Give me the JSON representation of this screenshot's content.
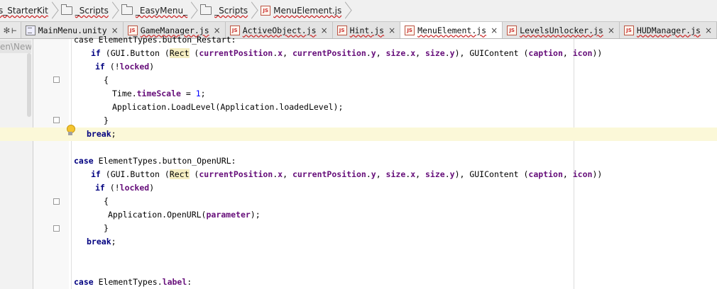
{
  "breadcrumbs": [
    {
      "label": "s_StarterKit",
      "icon": "folder-icon"
    },
    {
      "label": "_Scripts",
      "icon": "folder-icon"
    },
    {
      "label": "_EasyMenu_",
      "icon": "folder-icon"
    },
    {
      "label": "_Scripts",
      "icon": "folder-icon"
    },
    {
      "label": "MenuElement.js",
      "icon": "js-file-icon"
    }
  ],
  "project_path": "en\\New",
  "tabs": [
    {
      "label": "MainMenu.unity",
      "icon": "unity-scene-icon",
      "active": false,
      "error": false
    },
    {
      "label": "GameManager.js",
      "icon": "js-file-icon",
      "active": false,
      "error": true
    },
    {
      "label": "ActiveObject.js",
      "icon": "js-file-icon",
      "active": false,
      "error": true
    },
    {
      "label": "Hint.js",
      "icon": "js-file-icon",
      "active": false,
      "error": true
    },
    {
      "label": "MenuElement.js",
      "icon": "js-file-icon",
      "active": true,
      "error": true
    },
    {
      "label": "LevelsUnlocker.js",
      "icon": "js-file-icon",
      "active": false,
      "error": true
    },
    {
      "label": "HUDManager.js",
      "icon": "js-file-icon",
      "active": false,
      "error": true
    }
  ],
  "js_badge": "JS",
  "close_glyph": "×",
  "code_lines": [
    {
      "indent": 104,
      "parts": [
        [
          "plain",
          "case ElementTypes.button_Restart:"
        ]
      ]
    },
    {
      "indent": 128,
      "parts": [
        [
          "kw",
          "if "
        ],
        [
          "plain",
          "(GUI.Button ("
        ],
        [
          "rect",
          "Rect"
        ],
        [
          "plain",
          " ("
        ],
        [
          "prop",
          "currentPosition"
        ],
        [
          "plain",
          "."
        ],
        [
          "prop",
          "x"
        ],
        [
          "plain",
          ", "
        ],
        [
          "prop",
          "currentPosition"
        ],
        [
          "plain",
          "."
        ],
        [
          "prop",
          "y"
        ],
        [
          "plain",
          ", "
        ],
        [
          "prop",
          "size"
        ],
        [
          "plain",
          "."
        ],
        [
          "prop",
          "x"
        ],
        [
          "plain",
          ", "
        ],
        [
          "prop",
          "size"
        ],
        [
          "plain",
          "."
        ],
        [
          "prop",
          "y"
        ],
        [
          "plain",
          "), GUIContent ("
        ],
        [
          "prop",
          "caption"
        ],
        [
          "plain",
          ", "
        ],
        [
          "prop",
          "icon"
        ],
        [
          "plain",
          "))"
        ]
      ]
    },
    {
      "indent": 134,
      "parts": [
        [
          "kw",
          "if "
        ],
        [
          "plain",
          "(!"
        ],
        [
          "prop",
          "locked"
        ],
        [
          "plain",
          ")"
        ]
      ]
    },
    {
      "indent": 146,
      "parts": [
        [
          "plain",
          "{"
        ]
      ]
    },
    {
      "indent": 158,
      "parts": [
        [
          "plain",
          "Time."
        ],
        [
          "prop",
          "timeScale"
        ],
        [
          "plain",
          " = "
        ],
        [
          "num",
          "1"
        ],
        [
          "plain",
          ";"
        ]
      ]
    },
    {
      "indent": 158,
      "parts": [
        [
          "plain",
          "Application.LoadLevel(Application.loadedLevel);"
        ]
      ]
    },
    {
      "indent": 146,
      "parts": [
        [
          "plain",
          "}"
        ]
      ]
    },
    {
      "indent": 122,
      "parts": [
        [
          "kw",
          "break"
        ],
        [
          "plain",
          ";"
        ]
      ],
      "highlight": true
    },
    {
      "indent": 104,
      "parts": []
    },
    {
      "indent": 104,
      "parts": [
        [
          "kw",
          "case "
        ],
        [
          "plain",
          "ElementTypes.button_OpenURL:"
        ]
      ]
    },
    {
      "indent": 128,
      "parts": [
        [
          "kw",
          "if "
        ],
        [
          "plain",
          "(GUI.Button ("
        ],
        [
          "rect",
          "Rect"
        ],
        [
          "plain",
          " ("
        ],
        [
          "prop",
          "currentPosition"
        ],
        [
          "plain",
          "."
        ],
        [
          "prop",
          "x"
        ],
        [
          "plain",
          ", "
        ],
        [
          "prop",
          "currentPosition"
        ],
        [
          "plain",
          "."
        ],
        [
          "prop",
          "y"
        ],
        [
          "plain",
          ", "
        ],
        [
          "prop",
          "size"
        ],
        [
          "plain",
          "."
        ],
        [
          "prop",
          "x"
        ],
        [
          "plain",
          ", "
        ],
        [
          "prop",
          "size"
        ],
        [
          "plain",
          "."
        ],
        [
          "prop",
          "y"
        ],
        [
          "plain",
          "), GUIContent ("
        ],
        [
          "prop",
          "caption"
        ],
        [
          "plain",
          ", "
        ],
        [
          "prop",
          "icon"
        ],
        [
          "plain",
          "))"
        ]
      ]
    },
    {
      "indent": 134,
      "parts": [
        [
          "kw",
          "if "
        ],
        [
          "plain",
          "(!"
        ],
        [
          "prop",
          "locked"
        ],
        [
          "plain",
          ")"
        ]
      ]
    },
    {
      "indent": 146,
      "parts": [
        [
          "plain",
          "{"
        ]
      ]
    },
    {
      "indent": 152,
      "parts": [
        [
          "plain",
          "Application.OpenURL("
        ],
        [
          "prop",
          "parameter"
        ],
        [
          "plain",
          ");"
        ]
      ]
    },
    {
      "indent": 146,
      "parts": [
        [
          "plain",
          "}"
        ]
      ]
    },
    {
      "indent": 122,
      "parts": [
        [
          "kw",
          "break"
        ],
        [
          "plain",
          ";"
        ]
      ]
    },
    {
      "indent": 104,
      "parts": []
    },
    {
      "indent": 104,
      "parts": []
    },
    {
      "indent": 104,
      "parts": [
        [
          "kw",
          "case "
        ],
        [
          "plain",
          "ElementTypes."
        ],
        [
          "prop",
          "label"
        ],
        [
          "plain",
          ":"
        ]
      ]
    }
  ],
  "colors": {
    "keyword": "#000080",
    "property": "#660e7a",
    "number": "#0000ff",
    "current_line": "#fbf8d8"
  }
}
